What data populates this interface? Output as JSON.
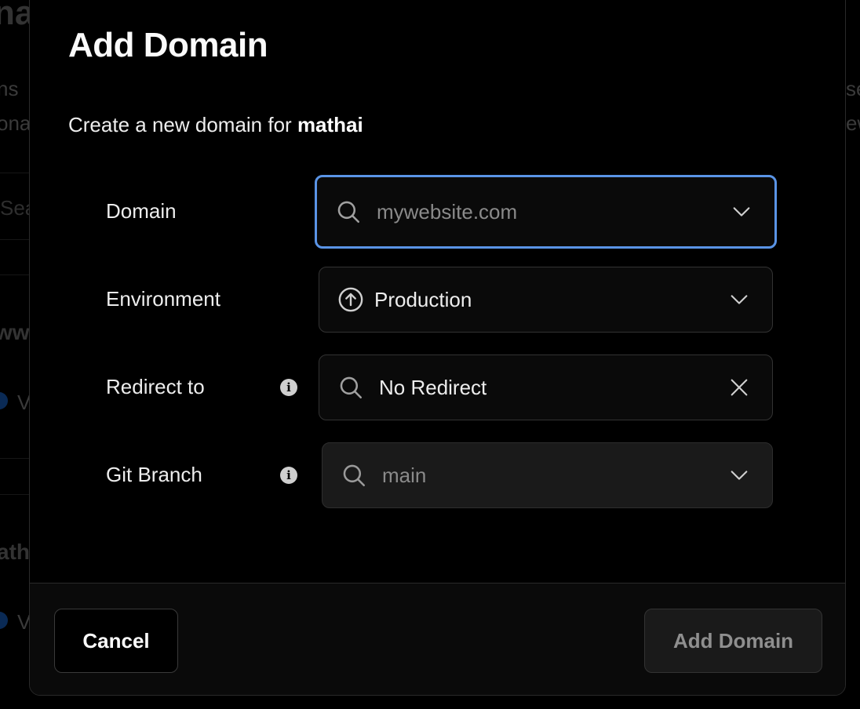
{
  "background": {
    "fragments_left": [
      "na",
      "ns",
      "ona",
      "Sea",
      "ww",
      "V",
      "ath",
      "V"
    ],
    "fragments_right": [
      "se",
      "ew"
    ]
  },
  "modal": {
    "title": "Add Domain",
    "description_prefix": "Create a new domain for ",
    "project_name": "mathai",
    "fields": {
      "domain": {
        "label": "Domain",
        "placeholder": "mywebsite.com",
        "icon": "search-icon",
        "trail_icon": "chevron-down-icon"
      },
      "environment": {
        "label": "Environment",
        "value": "Production",
        "icon": "arrow-up-circle-icon",
        "trail_icon": "chevron-down-icon"
      },
      "redirect": {
        "label": "Redirect to",
        "value": "No Redirect",
        "icon": "search-icon",
        "trail_icon": "close-icon",
        "info_icon": "info-icon"
      },
      "git_branch": {
        "label": "Git Branch",
        "placeholder": "main",
        "icon": "search-icon",
        "trail_icon": "chevron-down-icon",
        "info_icon": "info-icon"
      }
    },
    "footer": {
      "cancel_label": "Cancel",
      "submit_label": "Add Domain"
    }
  },
  "colors": {
    "focus_ring": "#5a94e6",
    "background": "#000000",
    "disabled_button_text": "#8f8f8f"
  }
}
